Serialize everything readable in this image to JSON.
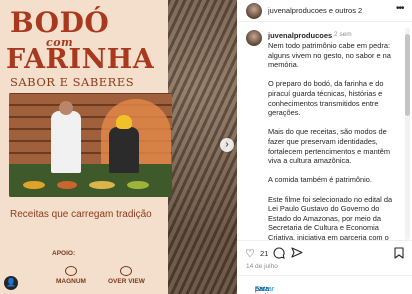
{
  "post_image": {
    "logo_line1": "BODÓ",
    "logo_line2": "com",
    "logo_line3": "FARINHA",
    "subtitle": "SABOR E SABERES",
    "caption": "Receitas que carregam tradição",
    "support_label": "APOIO:",
    "sponsors": [
      "MAGNUM",
      "OVER VIEW"
    ],
    "next_icon": "chevron-right-icon",
    "profile_icon": "person-icon"
  },
  "header": {
    "users": "juvenalproducoes e outros 2",
    "more_icon": "ellipsis-icon"
  },
  "comment": {
    "username": "juvenalproducoes",
    "time": "2 sem",
    "paragraphs": [
      "Nem todo patrimônio cabe em pedra: alguns vivem no gesto, no sabor e na memória.",
      "O preparo do bodó, da farinha e do piracuí guarda técnicas, histórias e conhecimentos transmitidos entre gerações.",
      "Mais do que receitas, são modos de fazer que preservam identidades, fortalecem pertencimentos e mantêm viva a cultura amazônica.",
      "A comida também é patrimônio.",
      "Este filme foi selecionado no edital da Lei Paulo Gustavo do Governo do Estado do Amazonas, por meio da Secretaria de Cultura e Economia Criativa, iniciativa em parceria com o Governo Federal e o Ministério da"
    ]
  },
  "actions": {
    "like_icon": "heart-icon",
    "like_count": "21",
    "comment_icon": "comment-icon",
    "share_icon": "send-icon",
    "save_icon": "bookmark-icon",
    "date": "14 de julho"
  },
  "add_comment": {
    "link_text": "Entrar",
    "rest_text": " para curtir ou comentar."
  },
  "colors": {
    "brand_red": "#a8391e",
    "link_blue": "#0095f6",
    "text": "#262626",
    "muted": "#8e8e8e"
  }
}
